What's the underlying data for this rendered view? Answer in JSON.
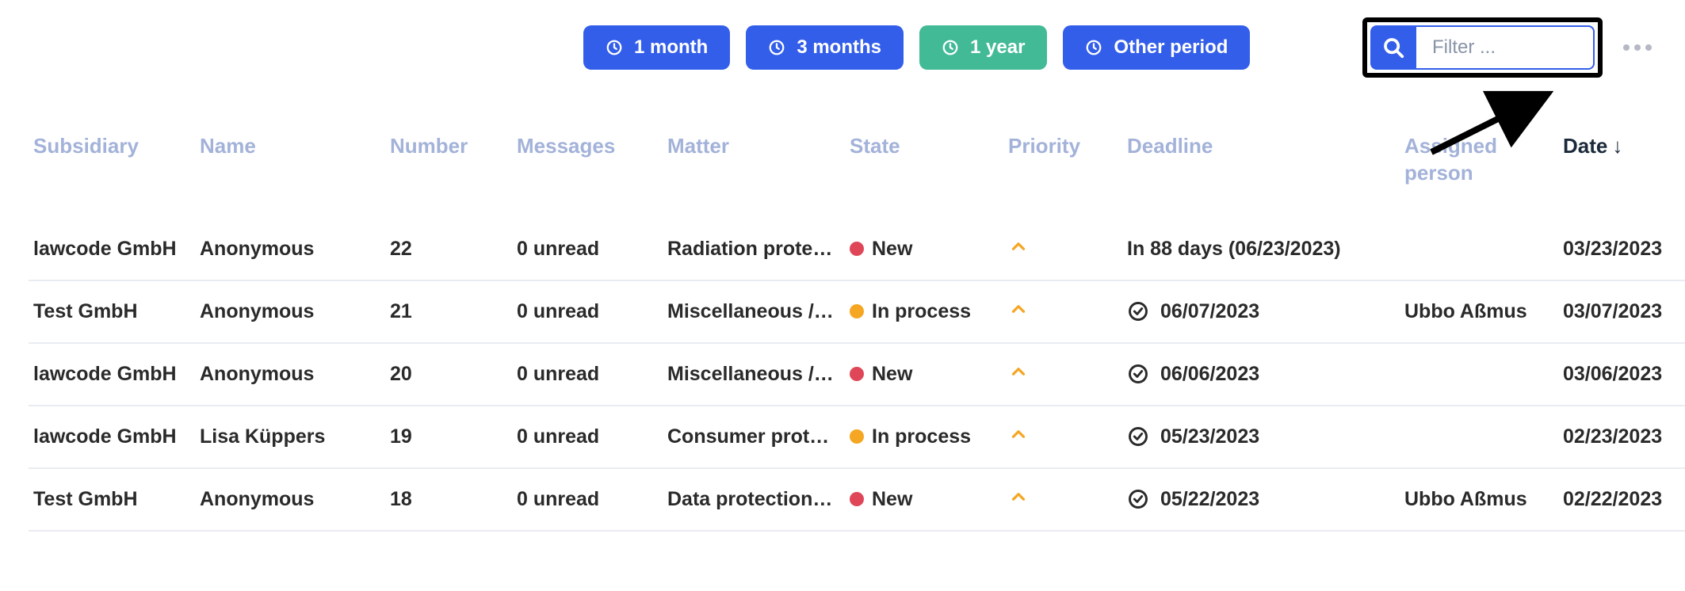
{
  "toolbar": {
    "periods": [
      {
        "label": "1 month",
        "style": "blue"
      },
      {
        "label": "3 months",
        "style": "blue"
      },
      {
        "label": "1 year",
        "style": "green"
      },
      {
        "label": "Other period",
        "style": "blue"
      }
    ],
    "search_placeholder": "Filter ..."
  },
  "columns": {
    "subsidiary": "Subsidiary",
    "name": "Name",
    "number": "Number",
    "messages": "Messages",
    "matter": "Matter",
    "state": "State",
    "priority": "Priority",
    "deadline": "Deadline",
    "assigned": "Assigned person",
    "date": "Date",
    "sort_indicator": "↓"
  },
  "rows": [
    {
      "subsidiary": "lawcode GmbH",
      "name": "Anonymous",
      "number": "22",
      "messages": "0 unread",
      "matter": "Radiation prote…",
      "state_color": "red",
      "state": "New",
      "deadline_icon": "none",
      "deadline": "In 88 days (06/23/2023)",
      "assigned": "",
      "date": "03/23/2023"
    },
    {
      "subsidiary": "Test GmbH",
      "name": "Anonymous",
      "number": "21",
      "messages": "0 unread",
      "matter": "Miscellaneous /…",
      "state_color": "orange",
      "state": "In process",
      "deadline_icon": "check",
      "deadline": "06/07/2023",
      "assigned": "Ubbo Aßmus",
      "date": "03/07/2023"
    },
    {
      "subsidiary": "lawcode GmbH",
      "name": "Anonymous",
      "number": "20",
      "messages": "0 unread",
      "matter": "Miscellaneous /…",
      "state_color": "red",
      "state": "New",
      "deadline_icon": "check",
      "deadline": "06/06/2023",
      "assigned": "",
      "date": "03/06/2023"
    },
    {
      "subsidiary": "lawcode GmbH",
      "name": "Lisa Küppers",
      "number": "19",
      "messages": "0 unread",
      "matter": "Consumer prot…",
      "state_color": "orange",
      "state": "In process",
      "deadline_icon": "check",
      "deadline": "05/23/2023",
      "assigned": "",
      "date": "02/23/2023"
    },
    {
      "subsidiary": "Test GmbH",
      "name": "Anonymous",
      "number": "18",
      "messages": "0 unread",
      "matter": "Data protection…",
      "state_color": "red",
      "state": "New",
      "deadline_icon": "check",
      "deadline": "05/22/2023",
      "assigned": "Ubbo Aßmus",
      "date": "02/22/2023"
    }
  ]
}
